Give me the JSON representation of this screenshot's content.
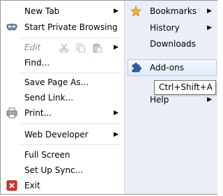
{
  "left_menu": {
    "new_tab": "New Tab",
    "private_browsing": "Start Private Browsing",
    "edit": "Edit",
    "find": "Find...",
    "save_page": "Save Page As...",
    "send_link": "Send Link...",
    "print": "Print...",
    "web_developer": "Web Developer",
    "full_screen": "Full Screen",
    "set_up_sync": "Set Up Sync...",
    "exit": "Exit"
  },
  "right_menu": {
    "bookmarks": "Bookmarks",
    "history": "History",
    "downloads": "Downloads",
    "addons": "Add-ons",
    "help": "Help"
  },
  "tooltip": {
    "text": "Ctrl+Shift+A"
  },
  "colors": {
    "right_pane_bg": "#e9eef7",
    "highlight_border": "#b8cde9",
    "accent_addons": "#2b5fa8",
    "exit_red": "#d9342b"
  },
  "icons": {
    "private_browsing": "mask-icon",
    "edit_cut": "scissors-icon",
    "edit_copy": "copy-icon",
    "edit_paste": "paste-icon",
    "print": "printer-icon",
    "exit": "exit-icon",
    "bookmarks": "star-icon",
    "addons": "puzzle-icon",
    "submenu": "chevron-right-icon"
  }
}
